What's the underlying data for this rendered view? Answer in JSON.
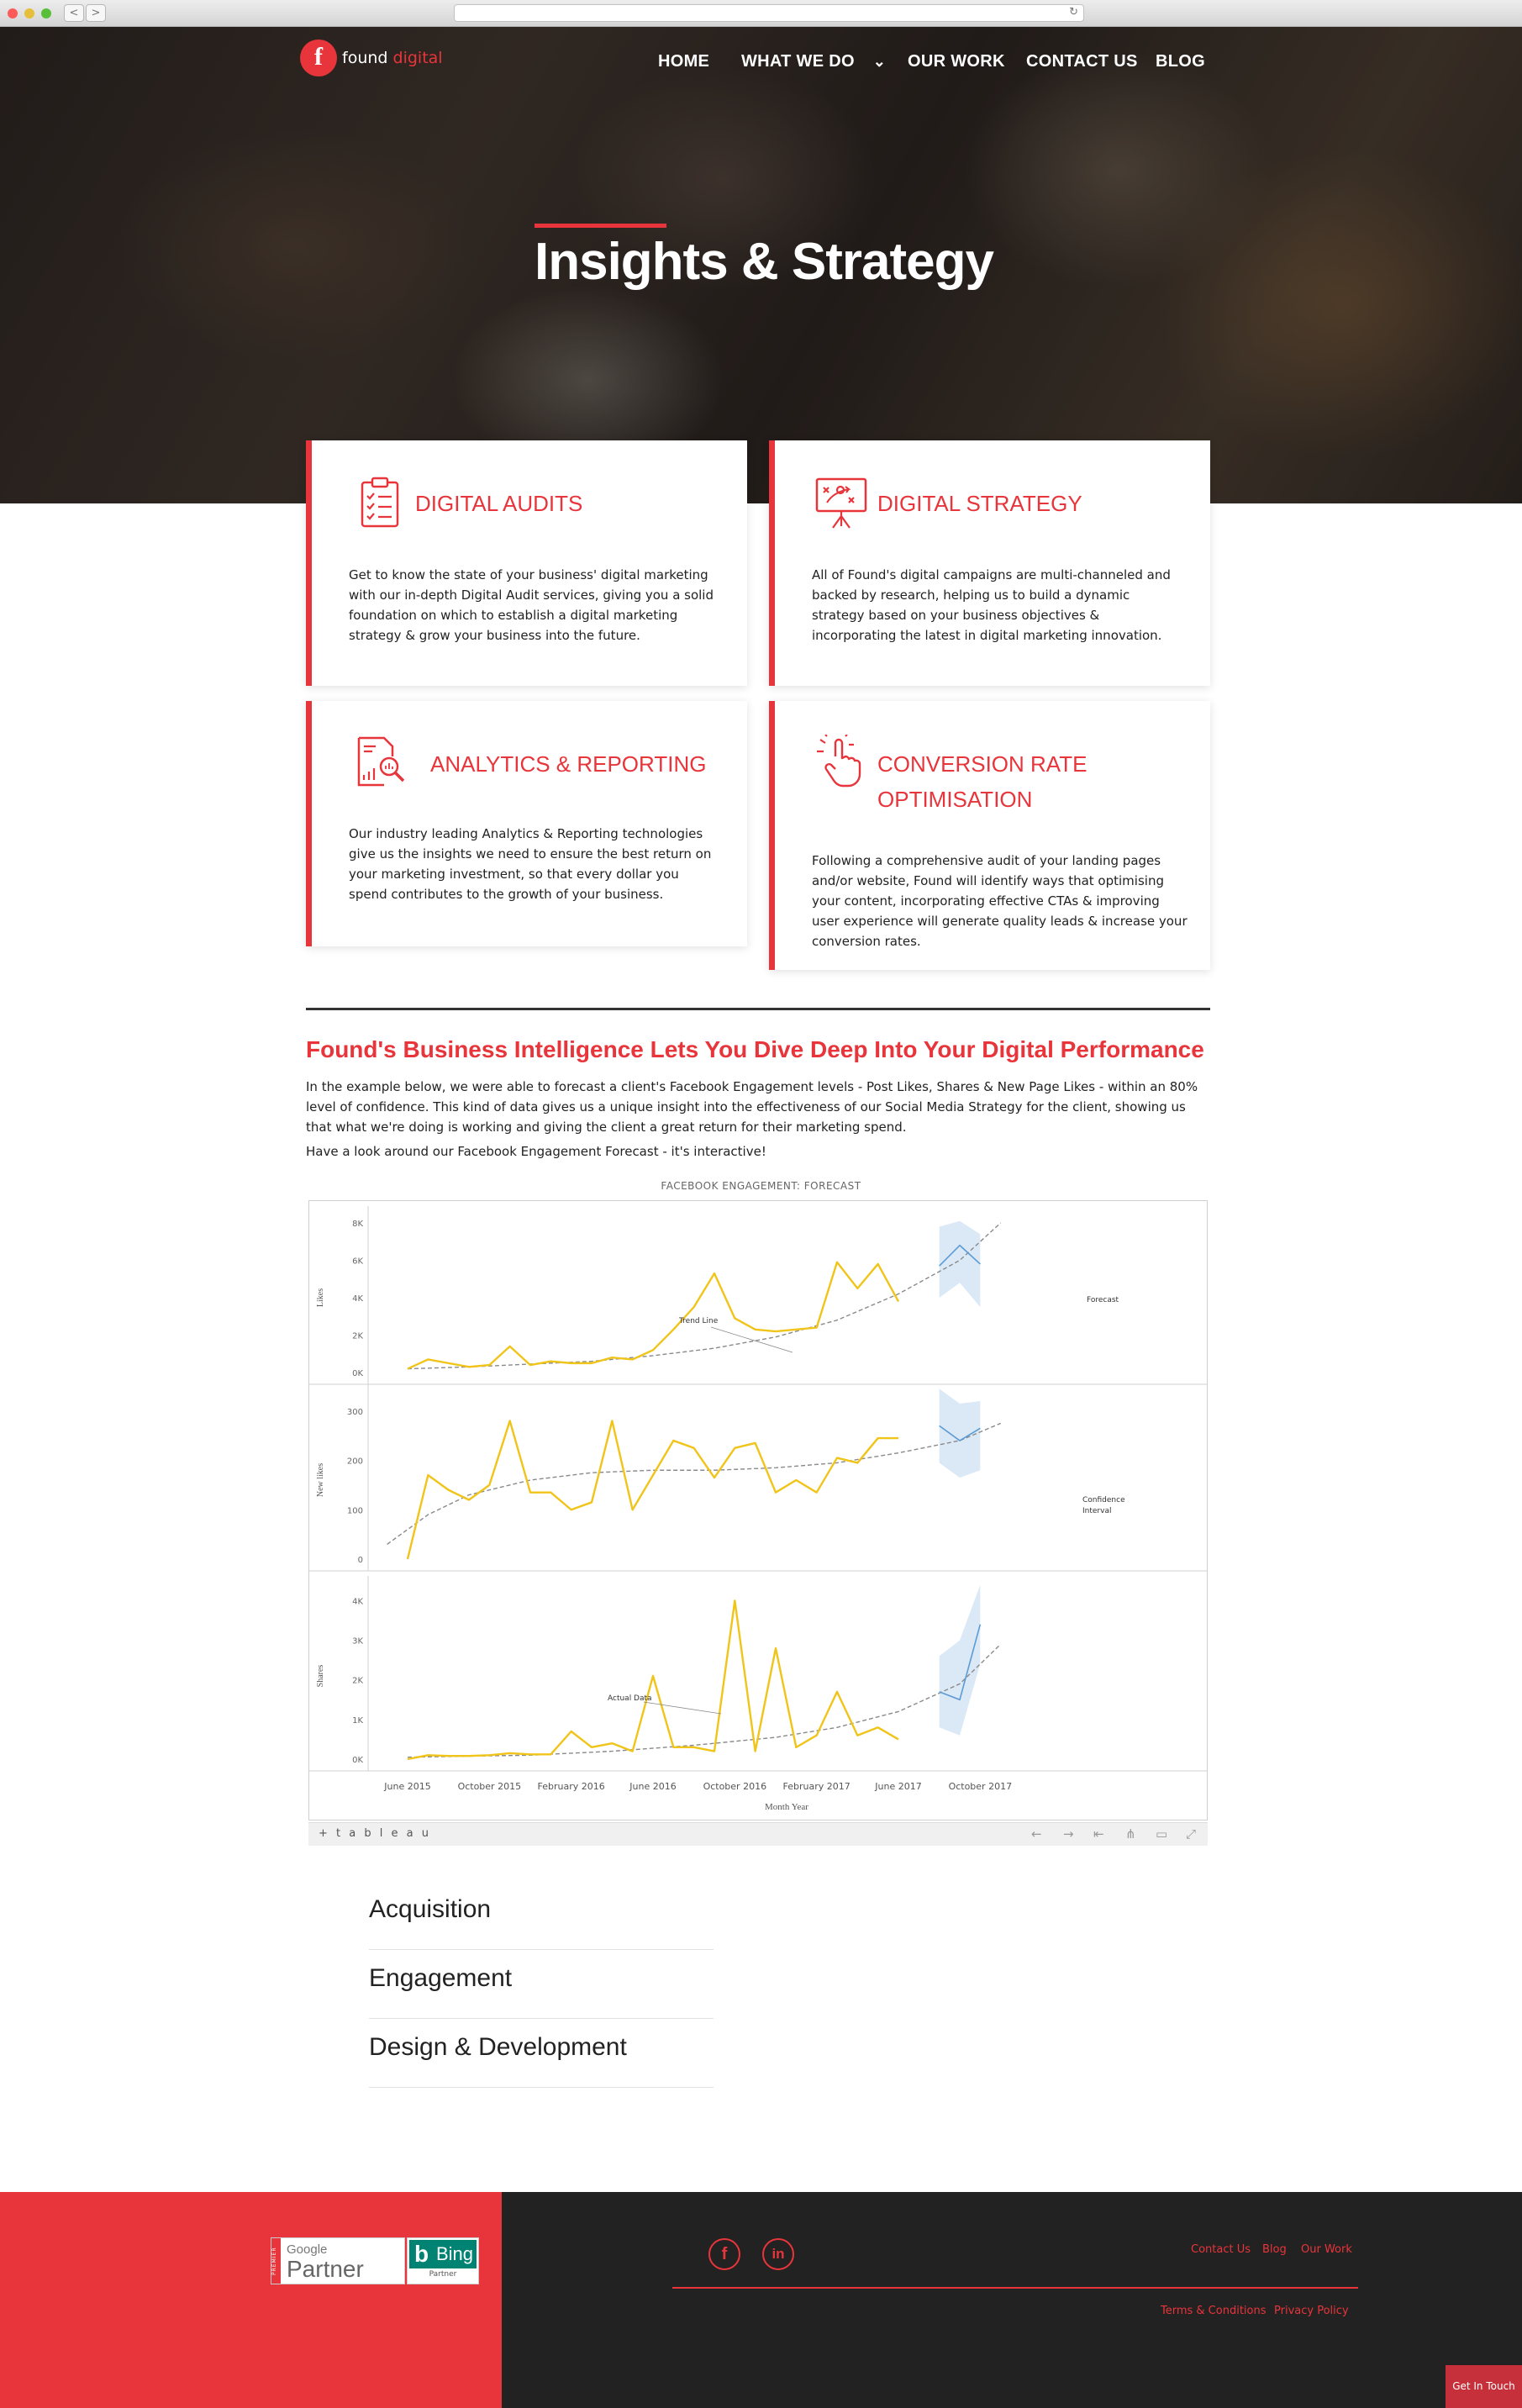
{
  "browser": {
    "back": "<",
    "forward": ">",
    "reload": "↻"
  },
  "logo": {
    "mark": "f",
    "word1": "found",
    "word2": "digital"
  },
  "nav": {
    "home": "HOME",
    "what": "WHAT WE DO",
    "what_caret": "⌄",
    "work": "OUR WORK",
    "contact": "CONTACT US",
    "blog": "BLOG"
  },
  "hero": {
    "title": "Insights & Strategy"
  },
  "cards": [
    {
      "title": "DIGITAL AUDITS",
      "icon": "clipboard-checklist-icon",
      "body": "Get to know the state of your business' digital marketing with our in-depth Digital Audit services, giving you a solid foundation on which to establish a digital marketing strategy & grow your business into the future."
    },
    {
      "title": "DIGITAL STRATEGY",
      "icon": "strategy-board-icon",
      "body": "All of Found's digital campaigns are multi-channeled and backed by research, helping us to build a dynamic strategy based on your business objectives & incorporating the latest in digital marketing innovation."
    },
    {
      "title": "ANALYTICS & REPORTING",
      "icon": "report-magnifier-icon",
      "body": "Our industry leading Analytics & Reporting technologies give us the insights we need to ensure the best return on your marketing investment, so that every dollar you spend contributes to the growth of your business."
    },
    {
      "title": "CONVERSION RATE OPTIMISATION",
      "icon": "click-hand-icon",
      "body": "Following a comprehensive audit of your landing pages and/or website, Found will identify ways that optimising your content, incorporating effective CTAs & improving user experience will generate quality leads & increase your conversion rates."
    }
  ],
  "section": {
    "heading": "Found's Business Intelligence Lets You Dive Deep Into Your Digital Performance",
    "p1": "In the example below, we were able to forecast a client's Facebook Engagement levels - Post Likes, Shares & New Page Likes - within an 80% level of confidence. This kind of data gives us a unique insight into the effectiveness of our Social Media Strategy for the client, showing us that what we're doing is working and giving the client a great return for their marketing spend.",
    "p2": "Have a look around our Facebook Engagement Forecast - it's interactive!"
  },
  "chart_data": {
    "type": "line",
    "title": "FACEBOOK ENGAGEMENT: FORECAST",
    "xlabel": "Month Year",
    "x_ticks": [
      "June 2015",
      "October 2015",
      "February 2016",
      "June 2016",
      "October 2016",
      "February 2017",
      "June 2017",
      "October 2017"
    ],
    "x": [
      "2015-06",
      "2015-07",
      "2015-08",
      "2015-09",
      "2015-10",
      "2015-11",
      "2015-12",
      "2016-01",
      "2016-02",
      "2016-03",
      "2016-04",
      "2016-05",
      "2016-06",
      "2016-07",
      "2016-08",
      "2016-09",
      "2016-10",
      "2016-11",
      "2016-12",
      "2017-01",
      "2017-02",
      "2017-03",
      "2017-04",
      "2017-05",
      "2017-06",
      "2017-07"
    ],
    "colors": {
      "actual": "#f0c419",
      "trend": "#8a8a8a",
      "forecast": "#5b9bd5",
      "interval": "#cfe2f3"
    },
    "annotations": [
      "Trend Line",
      "Forecast",
      "Confidence Interval",
      "Actual Data"
    ],
    "panels": [
      {
        "ylabel": "Likes",
        "yticks": [
          "0K",
          "2K",
          "4K",
          "6K",
          "8K"
        ],
        "ylim": [
          0,
          8000
        ],
        "actual": [
          200,
          700,
          500,
          300,
          400,
          1400,
          400,
          600,
          500,
          500,
          800,
          700,
          1200,
          2300,
          3500,
          5300,
          2900,
          2300,
          2200,
          2300,
          2400,
          5900,
          4500,
          5800,
          3800
        ],
        "trend": [
          [
            0,
            200
          ],
          [
            3,
            300
          ],
          [
            6,
            450
          ],
          [
            9,
            600
          ],
          [
            12,
            900
          ],
          [
            15,
            1300
          ],
          [
            18,
            1900
          ],
          [
            21,
            2800
          ],
          [
            24,
            4200
          ],
          [
            27,
            6000
          ],
          [
            29,
            8000
          ]
        ],
        "forecast": [
          5700,
          6800,
          5800
        ],
        "forecast_upper": [
          7800,
          8100,
          7400
        ],
        "forecast_lower": [
          4000,
          4800,
          3500
        ],
        "forecast_start": 26
      },
      {
        "ylabel": "New likes",
        "yticks": [
          "0",
          "100",
          "200",
          "300"
        ],
        "ylim": [
          0,
          320
        ],
        "actual": [
          0,
          170,
          140,
          120,
          150,
          280,
          135,
          135,
          100,
          115,
          280,
          100,
          170,
          240,
          225,
          165,
          225,
          235,
          135,
          160,
          135,
          205,
          195,
          245,
          245
        ],
        "trend": [
          [
            -1,
            30
          ],
          [
            1,
            90
          ],
          [
            3,
            130
          ],
          [
            6,
            160
          ],
          [
            9,
            175
          ],
          [
            12,
            180
          ],
          [
            15,
            180
          ],
          [
            18,
            185
          ],
          [
            21,
            195
          ],
          [
            24,
            215
          ],
          [
            27,
            240
          ],
          [
            29,
            275
          ]
        ],
        "forecast": [
          270,
          240,
          265
        ],
        "forecast_upper": [
          345,
          315,
          320
        ],
        "forecast_lower": [
          195,
          165,
          180
        ],
        "forecast_start": 26
      },
      {
        "ylabel": "Shares",
        "yticks": [
          "0K",
          "1K",
          "2K",
          "3K",
          "4K"
        ],
        "ylim": [
          0,
          4200
        ],
        "actual": [
          0,
          100,
          80,
          80,
          100,
          150,
          120,
          120,
          700,
          300,
          400,
          200,
          2100,
          300,
          300,
          200,
          4000,
          200,
          2800,
          300,
          600,
          1700,
          600,
          800,
          500
        ],
        "trend": [
          [
            0,
            50
          ],
          [
            6,
            100
          ],
          [
            10,
            200
          ],
          [
            14,
            350
          ],
          [
            18,
            550
          ],
          [
            21,
            800
          ],
          [
            24,
            1200
          ],
          [
            27,
            1900
          ],
          [
            29,
            2900
          ]
        ],
        "forecast": [
          1700,
          1500,
          3400
        ],
        "forecast_upper": [
          2600,
          3000,
          4400
        ],
        "forecast_lower": [
          800,
          600,
          2400
        ],
        "forecast_start": 26
      }
    ]
  },
  "tableau": {
    "logo": "+ t a b l e a u",
    "undo": "←",
    "redo": "→",
    "revert": "⇤",
    "share": "⋔",
    "comment": "▭",
    "fullscreen": "⤢"
  },
  "accordion": [
    "Acquisition",
    "Engagement",
    "Design & Development"
  ],
  "footer": {
    "badge_side": "PREMIER",
    "google": "Google",
    "partner": "Partner",
    "bing_mark": "b",
    "bing": "Bing",
    "bing_partner": "Partner",
    "facebook": "f",
    "linkedin": "in",
    "links": [
      "Contact Us",
      "Blog",
      "Our Work"
    ],
    "legal": [
      "Terms & Conditions",
      "Privacy Policy"
    ],
    "cta": "Get In Touch"
  }
}
